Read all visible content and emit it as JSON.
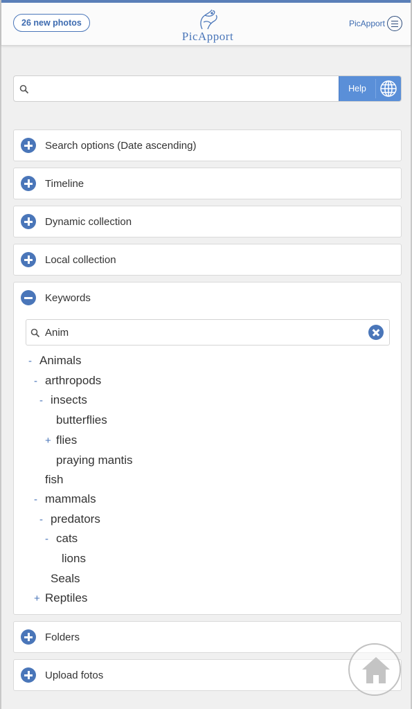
{
  "header": {
    "new_photos": "26 new photos",
    "logo_text": "PicApport",
    "app_menu_label": "PicApport"
  },
  "search": {
    "value": "",
    "placeholder": "",
    "help_label": "Help"
  },
  "panels": [
    {
      "label": "Search options (Date ascending)",
      "expanded": false
    },
    {
      "label": "Timeline",
      "expanded": false
    },
    {
      "label": "Dynamic collection",
      "expanded": false
    },
    {
      "label": "Local collection",
      "expanded": false
    },
    {
      "label": "Keywords",
      "expanded": true
    },
    {
      "label": "Folders",
      "expanded": false
    },
    {
      "label": "Upload fotos",
      "expanded": false
    }
  ],
  "keywords": {
    "filter_value": "Anim",
    "tree": [
      {
        "label": "Animals",
        "toggle": "-",
        "level": 0
      },
      {
        "label": "arthropods",
        "toggle": "-",
        "level": 1
      },
      {
        "label": "insects",
        "toggle": "-",
        "level": 2
      },
      {
        "label": "butterflies",
        "toggle": "",
        "level": 3
      },
      {
        "label": "flies",
        "toggle": "+",
        "level": 3
      },
      {
        "label": "praying mantis",
        "toggle": "",
        "level": 3
      },
      {
        "label": "fish",
        "toggle": "",
        "level": 1
      },
      {
        "label": "mammals",
        "toggle": "-",
        "level": 1
      },
      {
        "label": "predators",
        "toggle": "-",
        "level": 2
      },
      {
        "label": "cats",
        "toggle": "-",
        "level": 3
      },
      {
        "label": "lions",
        "toggle": "",
        "level": 4
      },
      {
        "label": "Seals",
        "toggle": "",
        "level": 2
      },
      {
        "label": "Reptiles",
        "toggle": "+",
        "level": 1
      }
    ]
  },
  "colors": {
    "accent": "#4a76b9",
    "help_button": "#5a8fd8",
    "header_border": "#5a7fb8"
  },
  "icons": [
    "search-icon",
    "globe-icon",
    "menu-icon",
    "plus-circle-icon",
    "minus-circle-icon",
    "clear-icon",
    "home-icon",
    "logo-icon"
  ]
}
